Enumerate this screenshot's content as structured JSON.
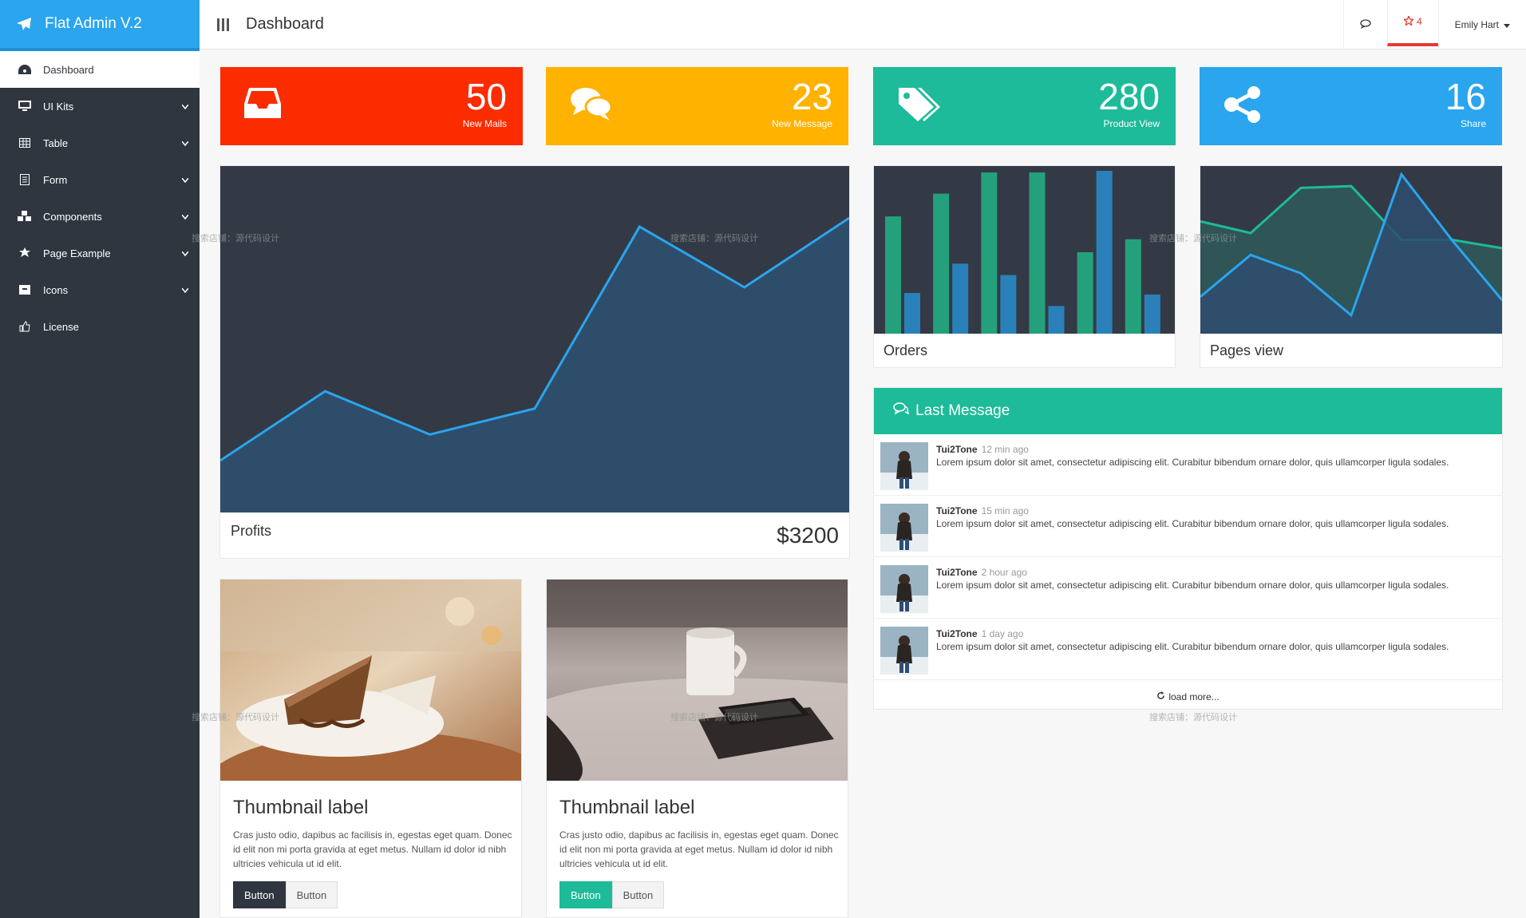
{
  "brand": {
    "title": "Flat Admin V.2",
    "icon": "paper-plane-icon",
    "color": "#2aa5ee"
  },
  "sidebar": {
    "items": [
      {
        "label": "Dashboard",
        "icon": "dashboard-icon",
        "active": true
      },
      {
        "label": "UI Kits",
        "icon": "monitor-icon"
      },
      {
        "label": "Table",
        "icon": "table-icon"
      },
      {
        "label": "Form",
        "icon": "form-icon"
      },
      {
        "label": "Components",
        "icon": "cubes-icon"
      },
      {
        "label": "Page Example",
        "icon": "puzzle-icon"
      },
      {
        "label": "Icons",
        "icon": "archive-icon"
      },
      {
        "label": "License",
        "icon": "thumbs-up-icon"
      }
    ]
  },
  "topbar": {
    "title": "Dashboard",
    "notifications_count": "4",
    "user_name": "Emily Hart"
  },
  "stats": [
    {
      "value": "50",
      "label": "New Mails",
      "color": "#fb2c00",
      "icon": "inbox-icon"
    },
    {
      "value": "23",
      "label": "New Message",
      "color": "#ffb200",
      "icon": "comments-icon"
    },
    {
      "value": "280",
      "label": "Product View",
      "color": "#1dbb99",
      "icon": "tags-icon"
    },
    {
      "value": "16",
      "label": "Share",
      "color": "#2aa5ee",
      "icon": "share-icon"
    }
  ],
  "profits": {
    "label": "Profits",
    "value": "$3200",
    "chart_data": {
      "type": "area",
      "values": [
        6,
        14,
        9,
        12,
        33,
        26,
        34
      ],
      "ylim": [
        0,
        40
      ],
      "color": "#2aa5ee"
    }
  },
  "orders": {
    "label": "Orders",
    "chart_data": {
      "type": "bar",
      "series": [
        {
          "values": [
            72,
            86,
            99,
            99,
            50,
            58
          ]
        },
        {
          "values": [
            25,
            43,
            36,
            17,
            100,
            24
          ]
        }
      ],
      "ylim": [
        0,
        100
      ],
      "colors": [
        "#24a17c",
        "#2a80b9"
      ]
    }
  },
  "pages_view": {
    "label": "Pages view",
    "chart_data": {
      "type": "area",
      "series": [
        {
          "values": [
            67,
            60,
            87,
            88,
            56,
            56,
            51
          ],
          "color": "#1dbb99"
        },
        {
          "values": [
            22,
            47,
            36,
            11,
            95,
            56,
            20
          ],
          "color": "#2aa5ee"
        }
      ],
      "ylim": [
        0,
        100
      ]
    }
  },
  "messages": {
    "title": "Last Message",
    "items": [
      {
        "name": "Tui2Tone",
        "time": "12 min ago",
        "text": "Lorem ipsum dolor sit amet, consectetur adipiscing elit. Curabitur bibendum ornare dolor, quis ullamcorper ligula sodales."
      },
      {
        "name": "Tui2Tone",
        "time": "15 min ago",
        "text": "Lorem ipsum dolor sit amet, consectetur adipiscing elit. Curabitur bibendum ornare dolor, quis ullamcorper ligula sodales."
      },
      {
        "name": "Tui2Tone",
        "time": "2 hour ago",
        "text": "Lorem ipsum dolor sit amet, consectetur adipiscing elit. Curabitur bibendum ornare dolor, quis ullamcorper ligula sodales."
      },
      {
        "name": "Tui2Tone",
        "time": "1 day ago",
        "text": "Lorem ipsum dolor sit amet, consectetur adipiscing elit. Curabitur bibendum ornare dolor, quis ullamcorper ligula sodales."
      }
    ],
    "load_more": "load more..."
  },
  "thumbnails": [
    {
      "title": "Thumbnail label",
      "text": "Cras justo odio, dapibus ac facilisis in, egestas eget quam. Donec id elit non mi porta gravida at eget metus. Nullam id dolor id nibh ultricies vehicula ut id elit.",
      "primary_button": "Button",
      "secondary_button": "Button"
    },
    {
      "title": "Thumbnail label",
      "text": "Cras justo odio, dapibus ac facilisis in, egestas eget quam. Donec id elit non mi porta gravida at eget metus. Nullam id dolor id nibh ultricies vehicula ut id elit.",
      "primary_button": "Button",
      "secondary_button": "Button"
    }
  ],
  "watermark": "搜索店铺：源代码设计"
}
